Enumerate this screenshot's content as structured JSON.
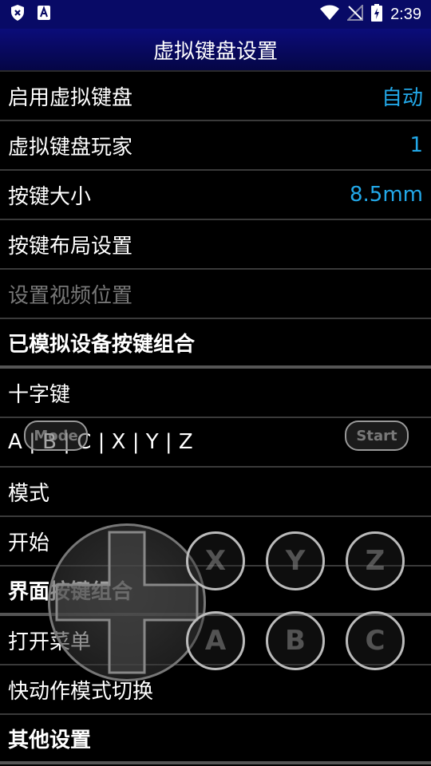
{
  "status_bar": {
    "time": "2:39",
    "icons": [
      "shield-x-icon",
      "font-a-icon",
      "wifi-icon",
      "signal-off-icon",
      "battery-charging-icon"
    ]
  },
  "header": {
    "title": "虚拟键盘设置"
  },
  "rows": [
    {
      "label": "启用虚拟键盘",
      "value": "自动"
    },
    {
      "label": "虚拟键盘玩家",
      "value": "1"
    },
    {
      "label": "按键大小",
      "value": "8.5mm"
    },
    {
      "label": "按键布局设置"
    },
    {
      "label": "设置视频位置"
    },
    {
      "label": "已模拟设备按键组合"
    },
    {
      "label": "十字键"
    },
    {
      "label": "A | B | C | X | Y | Z"
    },
    {
      "label": "模式"
    },
    {
      "label": "开始"
    },
    {
      "label": "界面按键组合"
    },
    {
      "label": "打开菜单"
    },
    {
      "label": "快动作模式切换"
    },
    {
      "label": "其他设置"
    }
  ],
  "gamepad": {
    "mode_label": "Mode",
    "start_label": "Start",
    "buttons": [
      "X",
      "Y",
      "Z",
      "A",
      "B",
      "C"
    ]
  },
  "colors": {
    "accent": "#22a8e8",
    "titlebar": "#080a66",
    "disabled": "#777777"
  }
}
